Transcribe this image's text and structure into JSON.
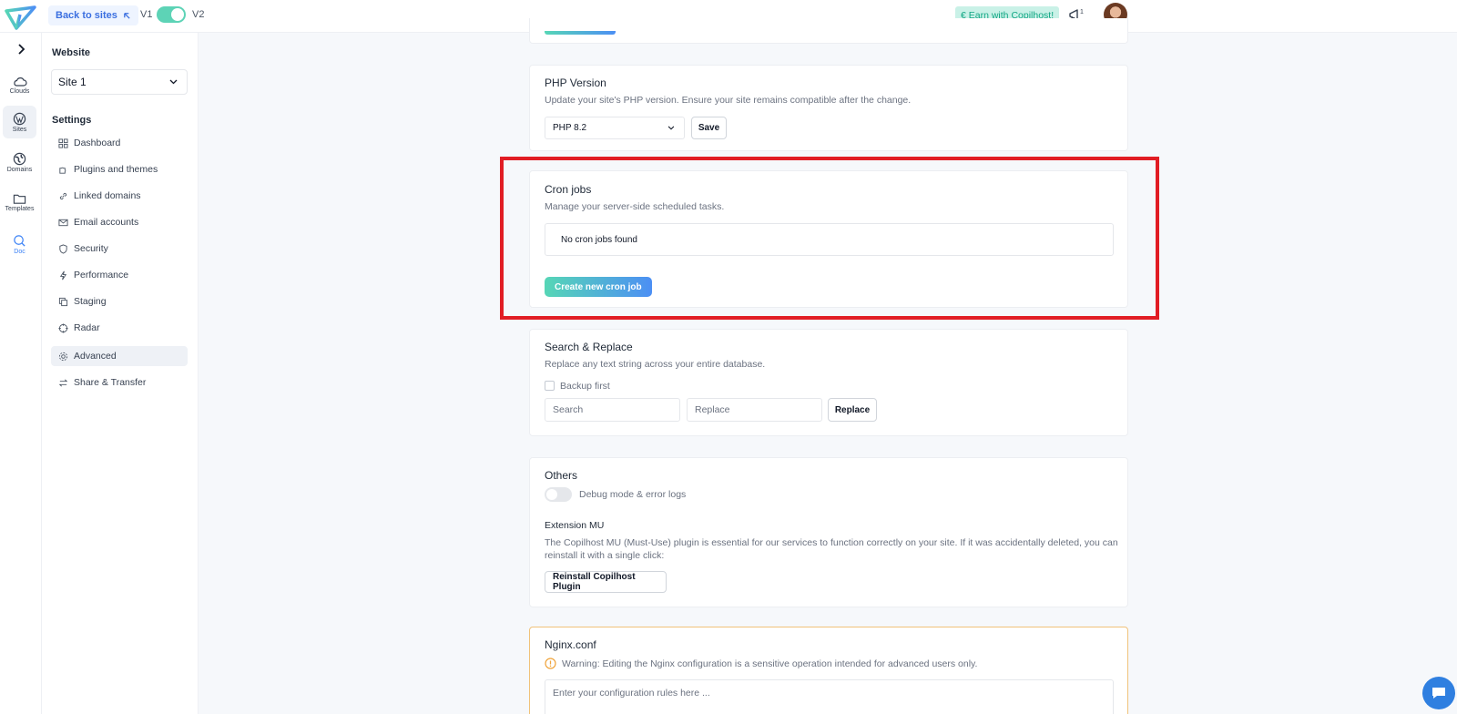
{
  "topbar": {
    "back_label": "Back to sites",
    "v1_label": "V1",
    "v2_label": "V2",
    "earn_label": "€ Earn with Copilhost!",
    "notification_count": "1"
  },
  "rail": {
    "items": [
      {
        "label": "Clouds",
        "icon": "cloud-icon"
      },
      {
        "label": "Sites",
        "icon": "wordpress-icon"
      },
      {
        "label": "Domains",
        "icon": "globe-icon"
      },
      {
        "label": "Templates",
        "icon": "folder-icon"
      },
      {
        "label": "Doc",
        "icon": "search-icon"
      }
    ]
  },
  "sidebar": {
    "website_heading": "Website",
    "site_value": "Site 1",
    "settings_heading": "Settings",
    "items": [
      {
        "label": "Dashboard"
      },
      {
        "label": "Plugins and themes"
      },
      {
        "label": "Linked domains"
      },
      {
        "label": "Email accounts"
      },
      {
        "label": "Security"
      },
      {
        "label": "Performance"
      },
      {
        "label": "Staging"
      },
      {
        "label": "Radar"
      },
      {
        "label": "Advanced"
      },
      {
        "label": "Share & Transfer"
      }
    ]
  },
  "php": {
    "title": "PHP Version",
    "desc": "Update your site's PHP version. Ensure your site remains compatible after the change.",
    "selected": "PHP 8.2",
    "save_label": "Save"
  },
  "cron": {
    "title": "Cron jobs",
    "desc": "Manage your server-side scheduled tasks.",
    "empty_text": "No cron jobs found",
    "create_label": "Create new cron job"
  },
  "search_replace": {
    "title": "Search & Replace",
    "desc": "Replace any text string across your entire database.",
    "backup_label": "Backup first",
    "search_placeholder": "Search",
    "replace_placeholder": "Replace",
    "replace_button": "Replace"
  },
  "others": {
    "title": "Others",
    "debug_label": "Debug mode & error logs",
    "ext_title": "Extension MU",
    "ext_desc_line1": "The Copilhost MU (Must-Use) plugin is essential for our services to function correctly on your site. If it was accidentally deleted, you can",
    "ext_desc_line2": "reinstall it with a single click:",
    "reinstall_label": "Reinstall Copilhost Plugin"
  },
  "nginx": {
    "title": "Nginx.conf",
    "warning": "Warning: Editing the Nginx configuration is a sensitive operation intended for advanced users only.",
    "placeholder": "Enter your configuration rules here ..."
  },
  "colors": {
    "accent": "#4c8ff4",
    "teal": "#56d6b6",
    "highlight": "#e11d24",
    "warning": "#f0a33a"
  }
}
